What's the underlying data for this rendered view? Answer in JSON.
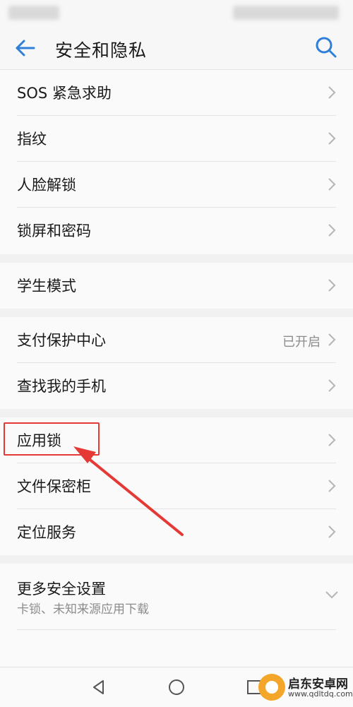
{
  "app_bar": {
    "title": "安全和隐私"
  },
  "groups": [
    {
      "items": [
        {
          "label": "SOS 紧急求助"
        },
        {
          "label": "指纹"
        },
        {
          "label": "人脸解锁"
        },
        {
          "label": "锁屏和密码"
        }
      ]
    },
    {
      "items": [
        {
          "label": "学生模式"
        }
      ]
    },
    {
      "items": [
        {
          "label": "支付保护中心",
          "value": "已开启"
        },
        {
          "label": "查找我的手机"
        }
      ]
    },
    {
      "items": [
        {
          "label": "应用锁"
        },
        {
          "label": "文件保密柜"
        },
        {
          "label": "定位服务"
        }
      ]
    },
    {
      "items": [
        {
          "label": "更多安全设置",
          "subtitle": "卡锁、未知来源应用下载"
        }
      ]
    }
  ],
  "annotation": {
    "color": "#e53935"
  },
  "accent_color": "#2f7ed8",
  "icons": {
    "back": "arrow-left-icon",
    "search": "search-icon",
    "chevron": "chevron-right-icon",
    "expand": "chevron-down-icon",
    "nav": [
      "back-triangle-icon",
      "home-circle-icon",
      "recents-square-icon"
    ]
  },
  "watermark": {
    "name": "启东安卓网",
    "url": "www.qdltdq.com"
  }
}
